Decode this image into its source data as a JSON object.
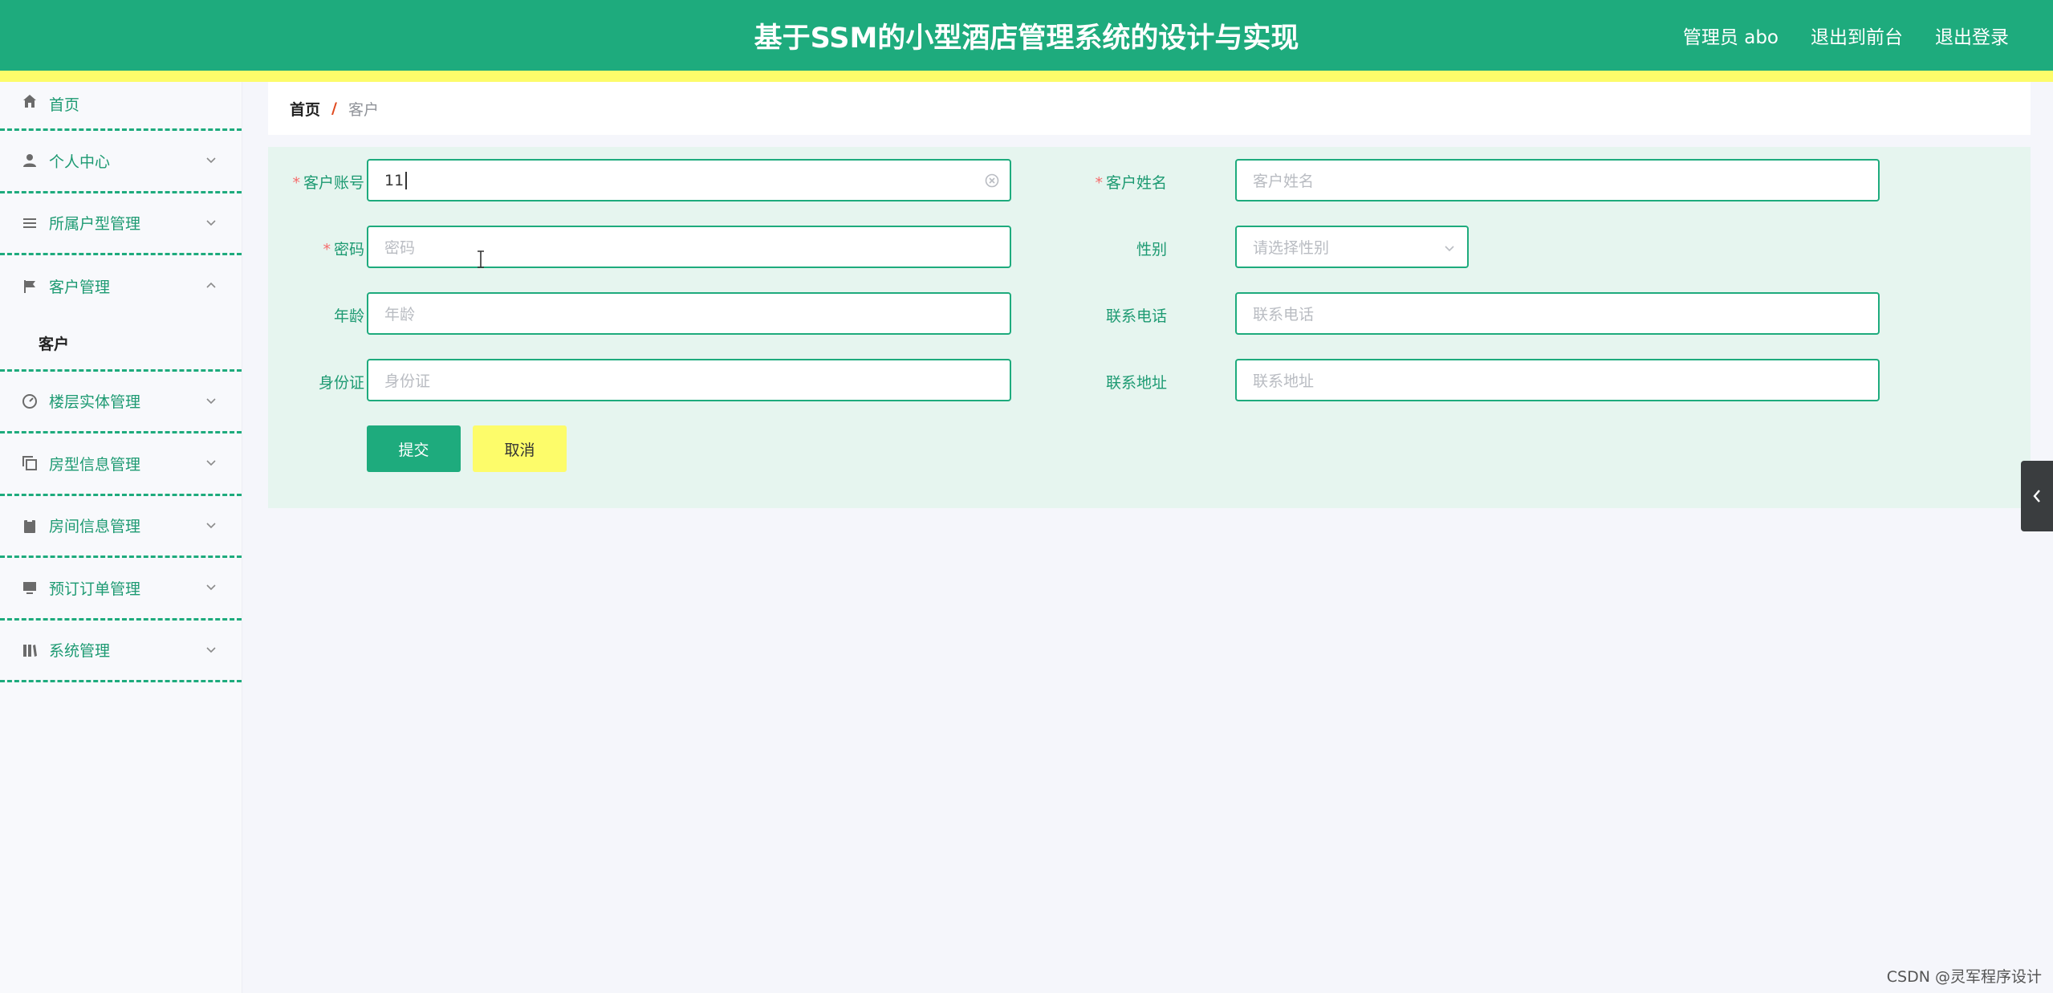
{
  "header": {
    "title": "基于SSM的小型酒店管理系统的设计与实现",
    "user": "管理员 abo",
    "to_front": "退出到前台",
    "logout": "退出登录"
  },
  "sidebar": {
    "items": [
      {
        "label": "首页",
        "icon": "home-icon"
      },
      {
        "label": "个人中心",
        "icon": "person-icon"
      },
      {
        "label": "所属户型管理",
        "icon": "list-icon"
      },
      {
        "label": "客户管理",
        "icon": "flag-icon",
        "open": true
      },
      {
        "label": "楼层实体管理",
        "icon": "dashboard-icon"
      },
      {
        "label": "房型信息管理",
        "icon": "copy-icon"
      },
      {
        "label": "房间信息管理",
        "icon": "clipboard-icon"
      },
      {
        "label": "预订订单管理",
        "icon": "monitor-icon"
      },
      {
        "label": "系统管理",
        "icon": "library-icon"
      }
    ],
    "submenu_label": "客户"
  },
  "breadcrumb": {
    "home": "首页",
    "separator": "/",
    "current": "客户"
  },
  "form": {
    "account_label": "客户账号",
    "account_value": "11",
    "name_label": "客户姓名",
    "name_placeholder": "客户姓名",
    "password_label": "密码",
    "password_placeholder": "密码",
    "gender_label": "性别",
    "gender_placeholder": "请选择性别",
    "age_label": "年龄",
    "age_placeholder": "年龄",
    "phone_label": "联系电话",
    "phone_placeholder": "联系电话",
    "idcard_label": "身份证",
    "idcard_placeholder": "身份证",
    "address_label": "联系地址",
    "address_placeholder": "联系地址",
    "required_mark": "*"
  },
  "buttons": {
    "submit": "提交",
    "cancel": "取消"
  },
  "watermark": "CSDN @灵军程序设计",
  "colors": {
    "primary": "#1eab7d",
    "accent_yellow": "#fdfc6a",
    "panel_bg": "#e6f5ef",
    "required": "#f56c6c"
  }
}
